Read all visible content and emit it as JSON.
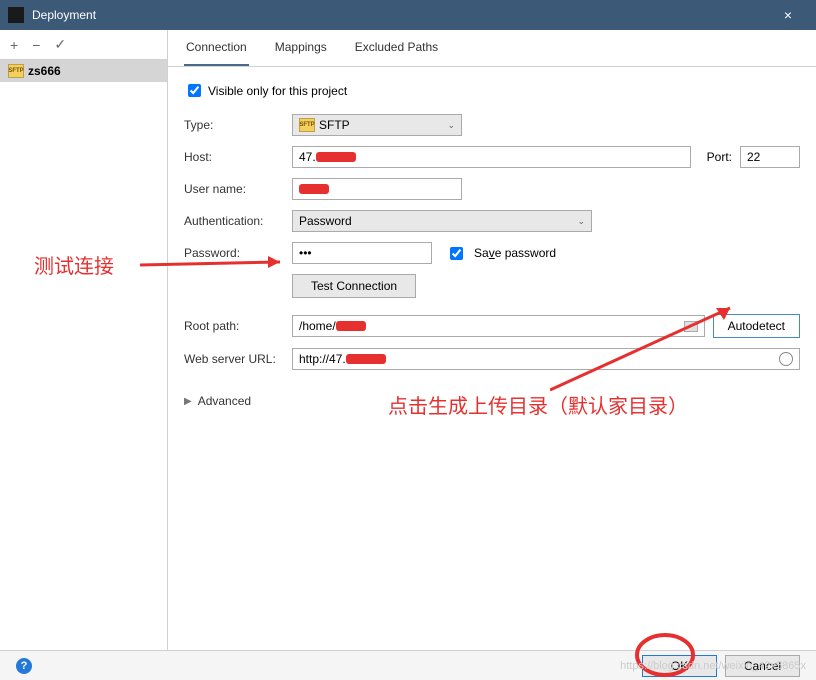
{
  "window": {
    "title": "Deployment",
    "close": "×"
  },
  "sidebar": {
    "toolbar": {
      "add": "+",
      "remove": "−",
      "check": "✓"
    },
    "server": {
      "name": "zs666",
      "icon_text": "SFTP"
    }
  },
  "tabs": {
    "connection": "Connection",
    "mappings": "Mappings",
    "excluded": "Excluded Paths"
  },
  "form": {
    "visible_only": "Visible only for this project",
    "visible_only_checked": true,
    "type_label": "Type:",
    "type_value": "SFTP",
    "host_label": "Host:",
    "host_value_prefix": "47.",
    "port_label": "Port:",
    "port_value": "22",
    "username_label": "User name:",
    "auth_label": "Authentication:",
    "auth_value": "Password",
    "password_label": "Password:",
    "password_value": "•••",
    "save_password": "Save password",
    "save_password_checked": true,
    "test_connection": "Test Connection",
    "root_path_label": "Root path:",
    "root_path_prefix": "/home/",
    "autodetect": "Autodetect",
    "web_url_label": "Web server URL:",
    "web_url_prefix": "http://47.",
    "advanced": "Advanced"
  },
  "footer": {
    "help": "?",
    "ok": "OK",
    "cancel": "Cancel"
  },
  "annotations": {
    "test_label": "测试连接",
    "autodetect_label": "点击生成上传目录（默认家目录）"
  },
  "watermark": "https://blog.csdn.net/weixin_42x5865x"
}
